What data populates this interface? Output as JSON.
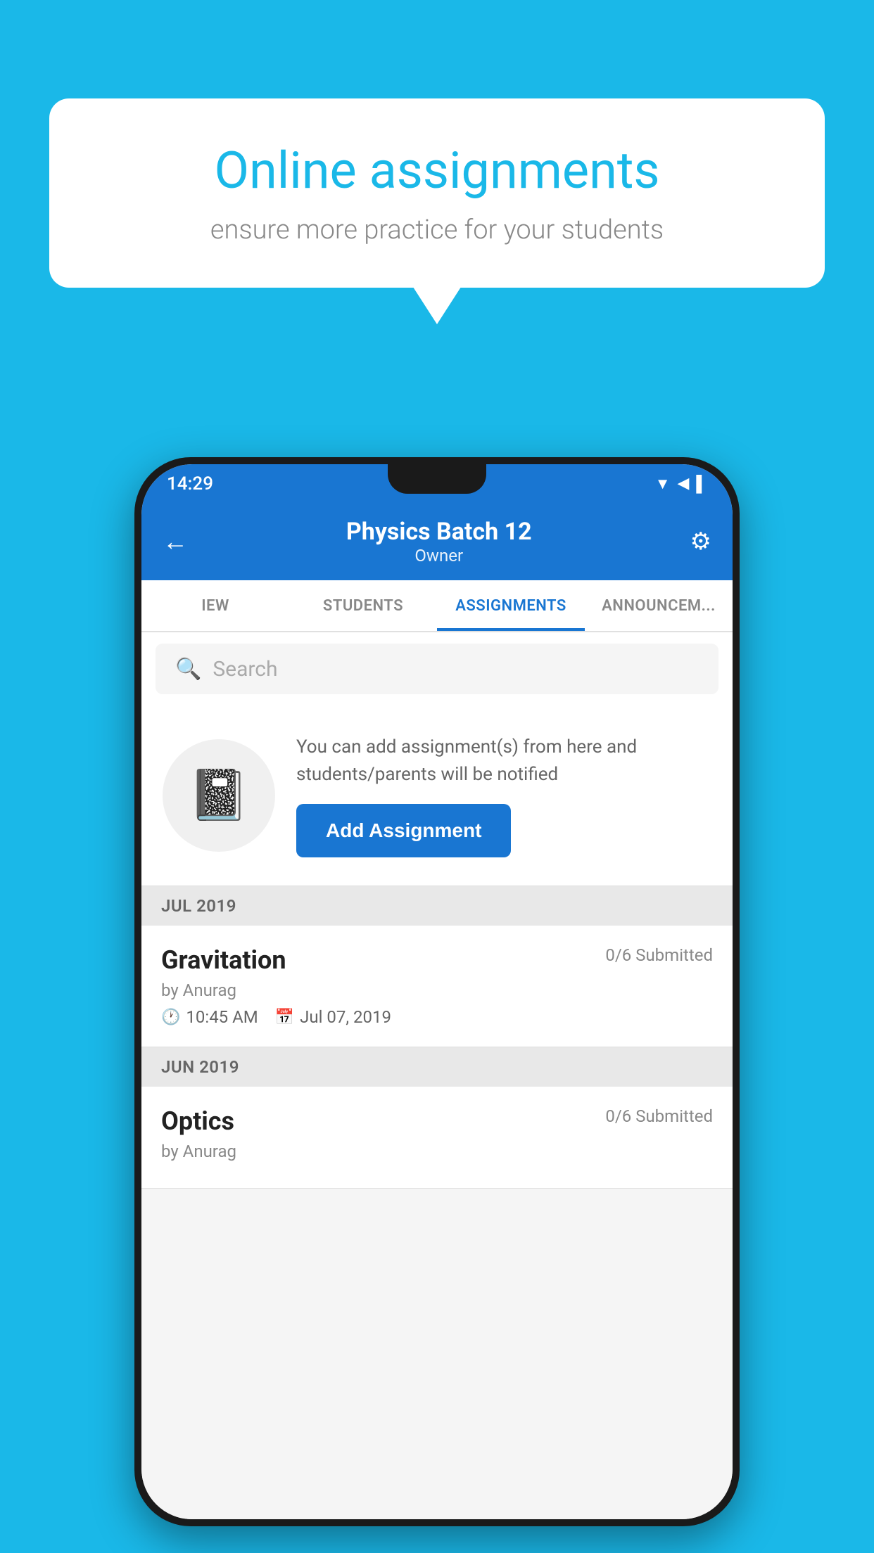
{
  "background_color": "#1ab8e8",
  "bubble": {
    "title": "Online assignments",
    "subtitle": "ensure more practice for your students"
  },
  "phone": {
    "status_bar": {
      "time": "14:29",
      "icons": "▼◀▌"
    },
    "header": {
      "title": "Physics Batch 12",
      "subtitle": "Owner",
      "back_label": "←",
      "settings_label": "⚙"
    },
    "tabs": [
      {
        "label": "IEW",
        "active": false
      },
      {
        "label": "STUDENTS",
        "active": false
      },
      {
        "label": "ASSIGNMENTS",
        "active": true
      },
      {
        "label": "ANNOUNCEM...",
        "active": false
      }
    ],
    "search": {
      "placeholder": "Search"
    },
    "add_card": {
      "description": "You can add assignment(s) from here and students/parents will be notified",
      "button_label": "Add Assignment"
    },
    "sections": [
      {
        "month": "JUL 2019",
        "assignments": [
          {
            "name": "Gravitation",
            "submitted": "0/6 Submitted",
            "by": "by Anurag",
            "time": "10:45 AM",
            "date": "Jul 07, 2019"
          }
        ]
      },
      {
        "month": "JUN 2019",
        "assignments": [
          {
            "name": "Optics",
            "submitted": "0/6 Submitted",
            "by": "by Anurag",
            "time": "",
            "date": ""
          }
        ]
      }
    ]
  }
}
